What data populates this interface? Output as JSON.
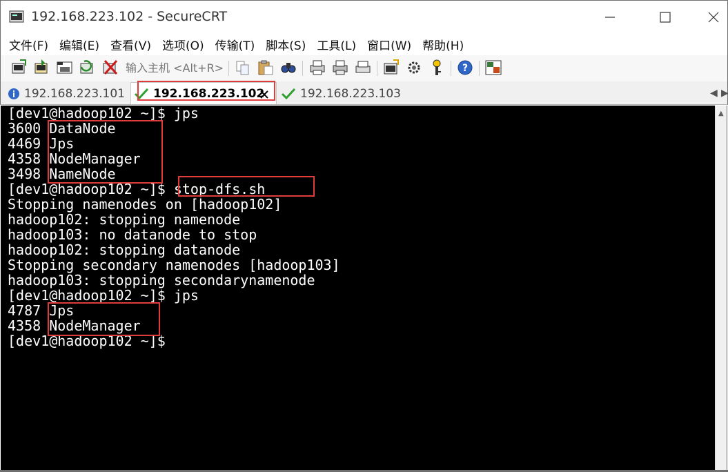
{
  "window": {
    "title": "192.168.223.102 - SecureCRT"
  },
  "menu": {
    "items": [
      "文件(F)",
      "编辑(E)",
      "查看(V)",
      "选项(O)",
      "传输(T)",
      "脚本(S)",
      "工具(L)",
      "窗口(W)",
      "帮助(H)"
    ]
  },
  "toolbar": {
    "quick_connect_placeholder": "输入主机 <Alt+R>"
  },
  "tabs": [
    {
      "label": "192.168.223.101",
      "status_icon": "info-icon",
      "active": false
    },
    {
      "label": "192.168.223.102",
      "status_icon": "check-icon",
      "active": true
    },
    {
      "label": "192.168.223.103",
      "status_icon": "check-icon",
      "active": false
    }
  ],
  "terminal": {
    "lines": [
      "[dev1@hadoop102 ~]$ jps",
      "3600 DataNode",
      "4469 Jps",
      "4358 NodeManager",
      "3498 NameNode",
      "[dev1@hadoop102 ~]$ stop-dfs.sh",
      "Stopping namenodes on [hadoop102]",
      "hadoop102: stopping namenode",
      "hadoop103: no datanode to stop",
      "hadoop102: stopping datanode",
      "Stopping secondary namenodes [hadoop103]",
      "hadoop103: stopping secondarynamenode",
      "[dev1@hadoop102 ~]$ jps",
      "4787 Jps",
      "4358 NodeManager",
      "[dev1@hadoop102 ~]$"
    ]
  },
  "colors": {
    "annotation": "#e03c3c",
    "terminal_bg": "#000000",
    "terminal_fg": "#ffffff"
  }
}
